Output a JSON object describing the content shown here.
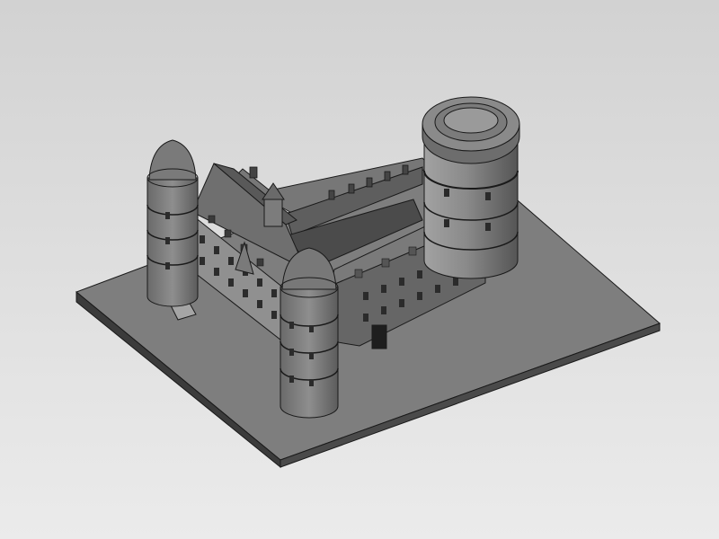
{
  "scene": {
    "subject": "castle-model",
    "render_style": "gray-shaded-cad",
    "colors": {
      "background_top": "#d2d2d2",
      "background_bottom": "#ebebeb",
      "base_top": "#7e7e7e",
      "base_side_left": "#3b3b3b",
      "base_side_right": "#4a4a4a",
      "wall_light": "#8c8c8c",
      "wall_dark": "#5a5a5a",
      "roof": "#6f6f6f",
      "outline": "#1a1a1a"
    }
  }
}
